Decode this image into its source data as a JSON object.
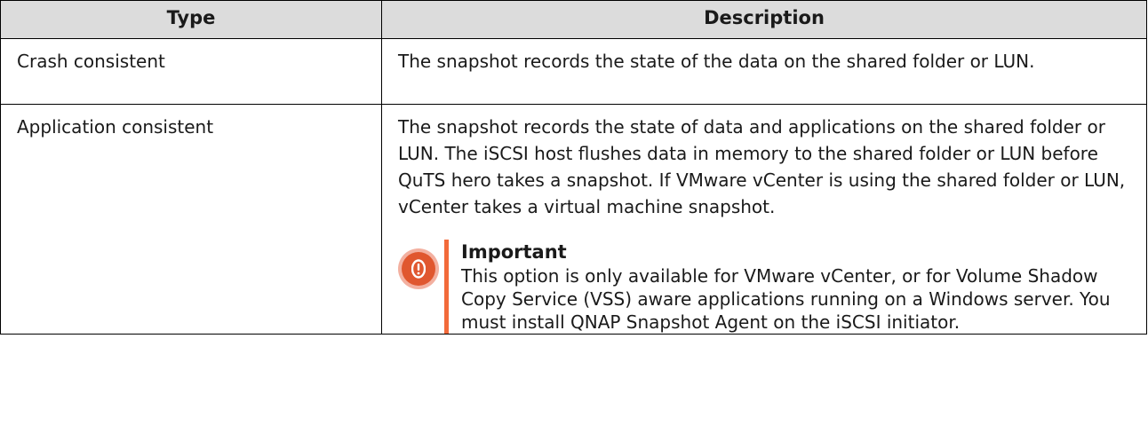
{
  "table": {
    "headers": [
      "Type",
      "Description"
    ],
    "rows": [
      {
        "type": "Crash consistent",
        "description": "The snapshot records the state of the data on the shared folder or LUN."
      },
      {
        "type": "Application consistent",
        "description": "The snapshot records the state of data and applications on the shared folder or LUN. The iSCSI host flushes data in memory to the shared folder or LUN before QuTS hero takes a snapshot. If VMware vCenter is using the shared folder or LUN, vCenter takes a virtual machine snapshot.",
        "note": {
          "icon": "important-exclamation-icon",
          "title": "Important",
          "text": "This option is only available for VMware vCenter, or for Volume Shadow Copy Service (VSS) aware applications running on a Windows server. You must install QNAP Snapshot Agent on the iSCSI initiator."
        }
      }
    ]
  },
  "colors": {
    "header_bg": "#dcdcdc",
    "note_accent": "#f26a3a",
    "note_icon": "#e0572f"
  }
}
